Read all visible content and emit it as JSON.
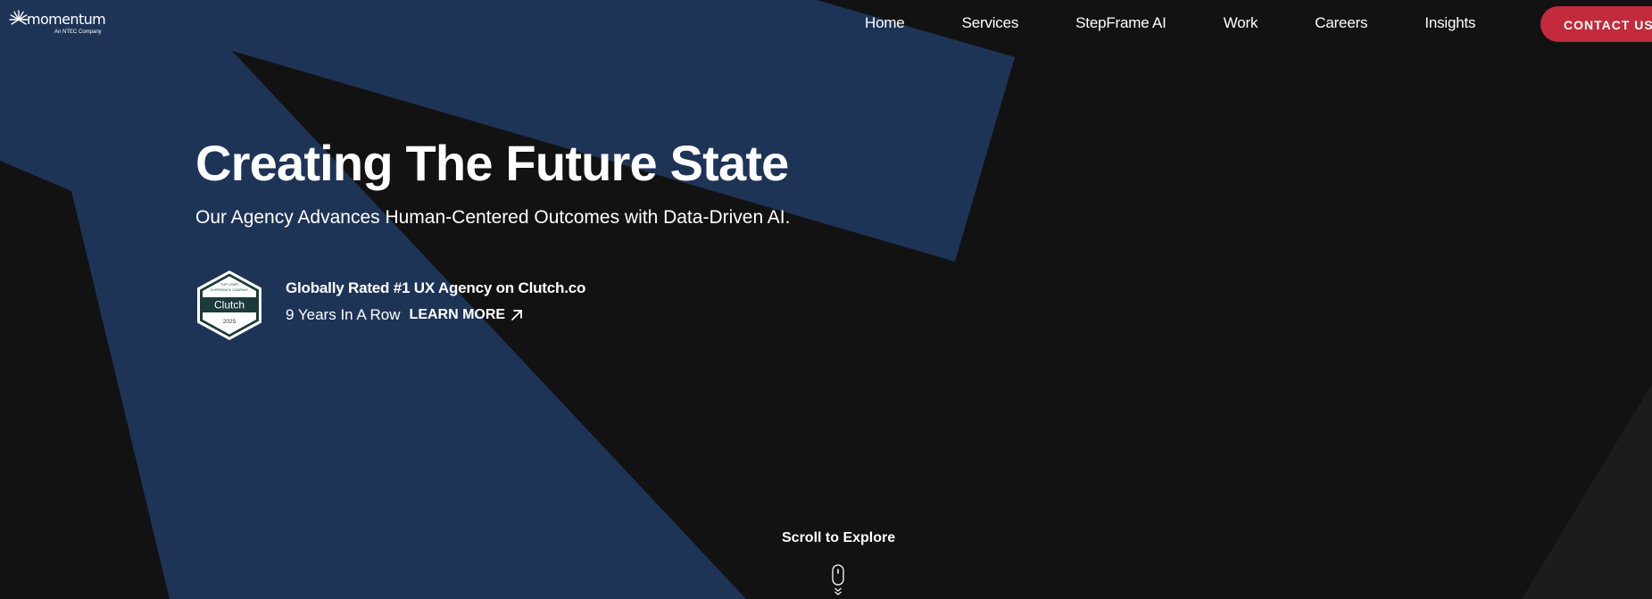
{
  "header": {
    "logo": {
      "wordmark": "momentum",
      "tagline": "An NTEC Company"
    },
    "nav": [
      {
        "label": "Home"
      },
      {
        "label": "Services"
      },
      {
        "label": "StepFrame AI"
      },
      {
        "label": "Work"
      },
      {
        "label": "Careers"
      },
      {
        "label": "Insights"
      }
    ],
    "contact_label": "CONTACT US"
  },
  "hero": {
    "title": "Creating The Future State",
    "subtitle": "Our Agency Advances Human-Centered Outcomes with Data-Driven AI.",
    "badge": {
      "top_line1": "TOP USER",
      "top_line2": "EXPERIENCE COMPANY",
      "brand": "Clutch",
      "year": "2025"
    },
    "rating_title": "Globally Rated #1 UX Agency on Clutch.co",
    "rating_years": "9 Years In A Row",
    "learn_more": "LEARN MORE"
  },
  "scroll": {
    "label": "Scroll to Explore"
  },
  "icons": {
    "logo": "starburst-icon",
    "learn_more": "arrow-up-right-icon",
    "scroll": "mouse-scroll-icon"
  },
  "colors": {
    "background": "#121212",
    "shape_blue": "#1e3457",
    "shape_gray": "#1c1c1c",
    "accent_red": "#c32b3c",
    "text": "#ffffff",
    "badge_dark": "#1c3a3a"
  }
}
